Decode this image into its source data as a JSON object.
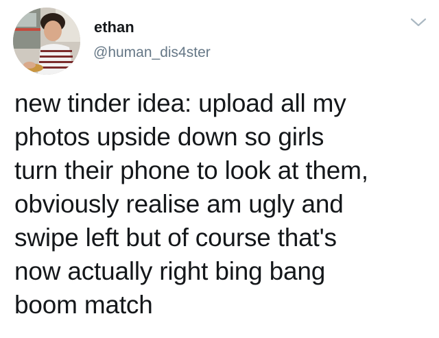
{
  "tweet": {
    "author": {
      "display_name": "ethan",
      "handle": "@human_dis4ster",
      "avatar_icon": "profile-photo"
    },
    "text": "new tinder idea: upload all my\nphotos upside down so girls\nturn their phone to look at them,\nobviously realise am ugly and\nswipe left but of course that's\nnow actually right bing bang\nboom match",
    "menu_icon": "chevron-down-icon"
  },
  "colors": {
    "text": "#14171a",
    "secondary_text": "#657786",
    "background": "#ffffff"
  }
}
